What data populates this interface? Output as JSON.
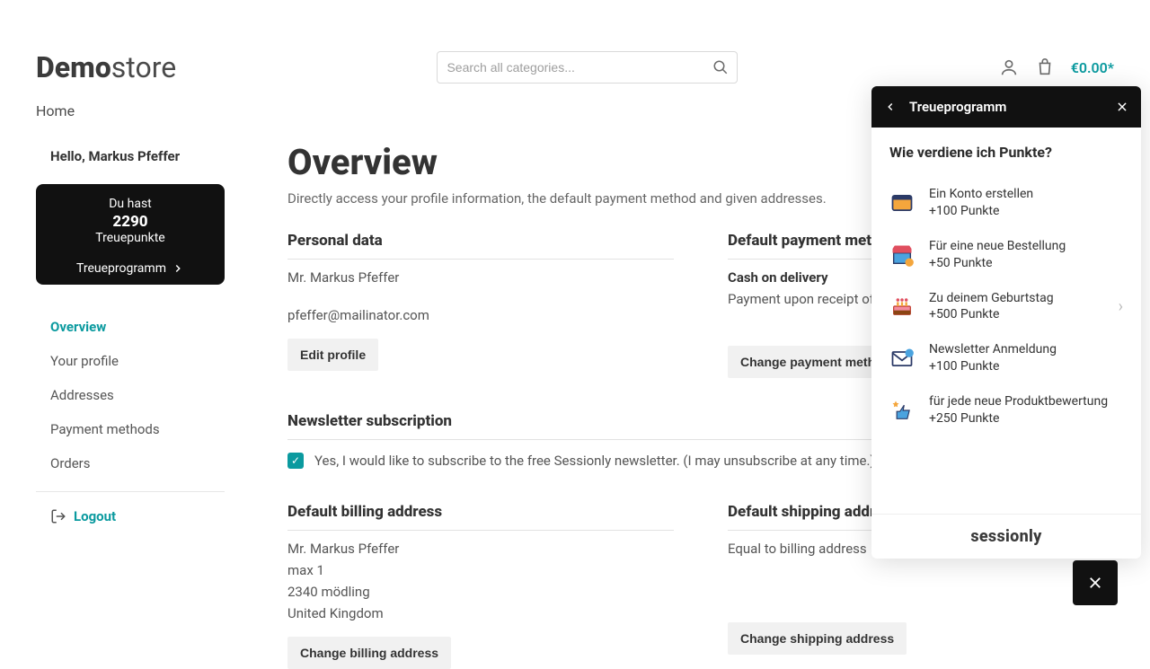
{
  "header": {
    "logo_bold": "Demo",
    "logo_light": "store",
    "search_placeholder": "Search all categories...",
    "cart_total": "€0.00*"
  },
  "nav": {
    "home": "Home"
  },
  "sidebar": {
    "hello": "Hello, Markus Pfeffer",
    "loyalty": {
      "line1": "Du hast",
      "points": "2290",
      "line2": "Treuepunkte",
      "link": "Treueprogramm"
    },
    "items": [
      {
        "label": "Overview",
        "active": true
      },
      {
        "label": "Your profile"
      },
      {
        "label": "Addresses"
      },
      {
        "label": "Payment methods"
      },
      {
        "label": "Orders"
      }
    ],
    "logout": "Logout"
  },
  "main": {
    "title": "Overview",
    "subtitle": "Directly access your profile information, the default payment method and given addresses.",
    "personal": {
      "title": "Personal data",
      "name": "Mr. Markus Pfeffer",
      "email": "pfeffer@mailinator.com",
      "btn": "Edit profile"
    },
    "payment": {
      "title": "Default payment method",
      "name": "Cash on delivery",
      "desc": "Payment upon receipt of goods.",
      "btn": "Change payment method"
    },
    "newsletter": {
      "title": "Newsletter subscription",
      "label": "Yes, I would like to subscribe to the free Sessionly newsletter. (I may unsubscribe at any time.)"
    },
    "billing": {
      "title": "Default billing address",
      "name": "Mr. Markus Pfeffer",
      "l1": "max 1",
      "l2": "2340 mödling",
      "l3": "United Kingdom",
      "btn": "Change billing address"
    },
    "shipping": {
      "title": "Default shipping address",
      "desc": "Equal to billing address",
      "btn": "Change shipping address"
    }
  },
  "panel": {
    "header": "Treueprogramm",
    "question": "Wie verdiene ich Punkte?",
    "items": [
      {
        "title": "Ein Konto erstellen",
        "pts": "+100 Punkte"
      },
      {
        "title": "Für eine neue Bestellung",
        "pts": "+50 Punkte"
      },
      {
        "title": "Zu deinem Geburtstag",
        "pts": "+500 Punkte",
        "chev": true
      },
      {
        "title": "Newsletter Anmeldung",
        "pts": "+100 Punkte"
      },
      {
        "title": "für jede neue Produktbewertung",
        "pts": "+250 Punkte"
      }
    ],
    "footer": "sessionly"
  }
}
